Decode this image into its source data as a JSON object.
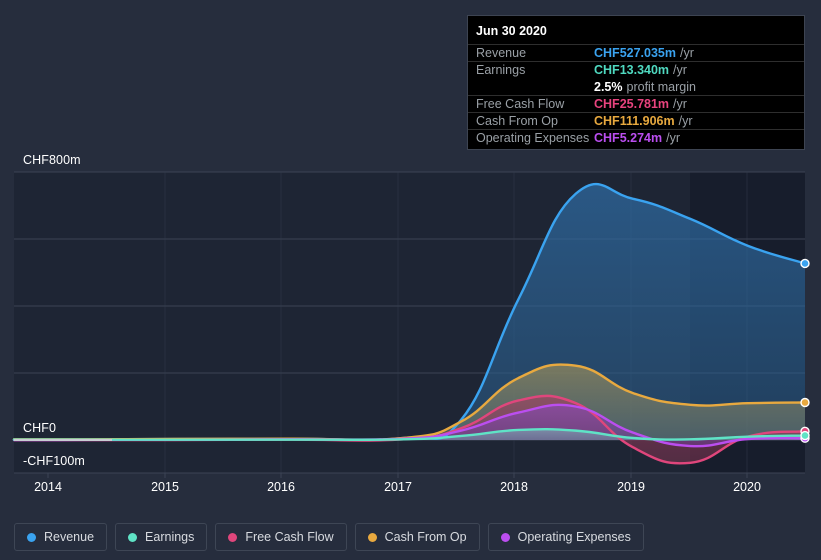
{
  "theme": {
    "background": "#262d3d",
    "plot_background": "#1e2534",
    "gridline": "#3c4455",
    "axis_text": "#ffffff",
    "forecast_band": "#151b2a"
  },
  "tooltip": {
    "date": "Jun 30 2020",
    "rows": [
      {
        "label": "Revenue",
        "value": "CHF527.035m",
        "suffix": "/yr",
        "color": "#3aa3f0"
      },
      {
        "label": "Earnings",
        "value": "CHF13.340m",
        "suffix": "/yr",
        "color": "#4fd9c0"
      },
      {
        "label": "",
        "value": "2.5%",
        "suffix": "profit margin",
        "color": "#ffffff"
      },
      {
        "label": "Free Cash Flow",
        "value": "CHF25.781m",
        "suffix": "/yr",
        "color": "#e8437e"
      },
      {
        "label": "Cash From Op",
        "value": "CHF111.906m",
        "suffix": "/yr",
        "color": "#e8a93f"
      },
      {
        "label": "Operating Expenses",
        "value": "CHF5.274m",
        "suffix": "/yr",
        "color": "#bb4ef0"
      }
    ]
  },
  "legend": {
    "items": [
      {
        "label": "Revenue",
        "color": "#3aa3f0"
      },
      {
        "label": "Earnings",
        "color": "#5fe3c6"
      },
      {
        "label": "Free Cash Flow",
        "color": "#e0467c"
      },
      {
        "label": "Cash From Op",
        "color": "#e8a93f"
      },
      {
        "label": "Operating Expenses",
        "color": "#bb4ef0"
      }
    ]
  },
  "chart_data": {
    "type": "area",
    "title": "",
    "xlabel": "",
    "ylabel": "",
    "currency": "CHF",
    "units": "millions",
    "grid": true,
    "legend_position": "bottom",
    "x_ticks": [
      "2014",
      "2015",
      "2016",
      "2017",
      "2018",
      "2019",
      "2020"
    ],
    "y_ticks": [
      "CHF800m",
      "CHF0",
      "-CHF100m"
    ],
    "ylim": [
      -100,
      800
    ],
    "y_gridline_values": [
      800,
      600,
      400,
      200,
      0
    ],
    "x": [
      2013.6,
      2014,
      2015,
      2016,
      2017,
      2017.5,
      2018,
      2018.5,
      2019,
      2019.5,
      2020,
      2020.5
    ],
    "series": [
      {
        "name": "Revenue",
        "color": "#3aa3f0",
        "values": [
          2,
          2,
          3,
          4,
          6,
          60,
          420,
          735,
          720,
          660,
          580,
          527.035
        ]
      },
      {
        "name": "Earnings",
        "color": "#5fe3c6",
        "values": [
          1,
          1,
          1,
          1,
          2,
          12,
          30,
          28,
          6,
          2,
          10,
          13.34
        ]
      },
      {
        "name": "Free Cash Flow",
        "color": "#e0467c",
        "values": [
          0,
          0,
          0,
          1,
          2,
          35,
          118,
          110,
          -22,
          -68,
          10,
          25.781
        ]
      },
      {
        "name": "Cash From Op",
        "color": "#e8a93f",
        "values": [
          2,
          2,
          3,
          4,
          6,
          55,
          185,
          222,
          140,
          105,
          110,
          111.906
        ]
      },
      {
        "name": "Operating Expenses",
        "color": "#bb4ef0",
        "values": [
          0,
          0,
          1,
          2,
          4,
          28,
          82,
          100,
          22,
          -18,
          3,
          5.274
        ]
      }
    ]
  }
}
